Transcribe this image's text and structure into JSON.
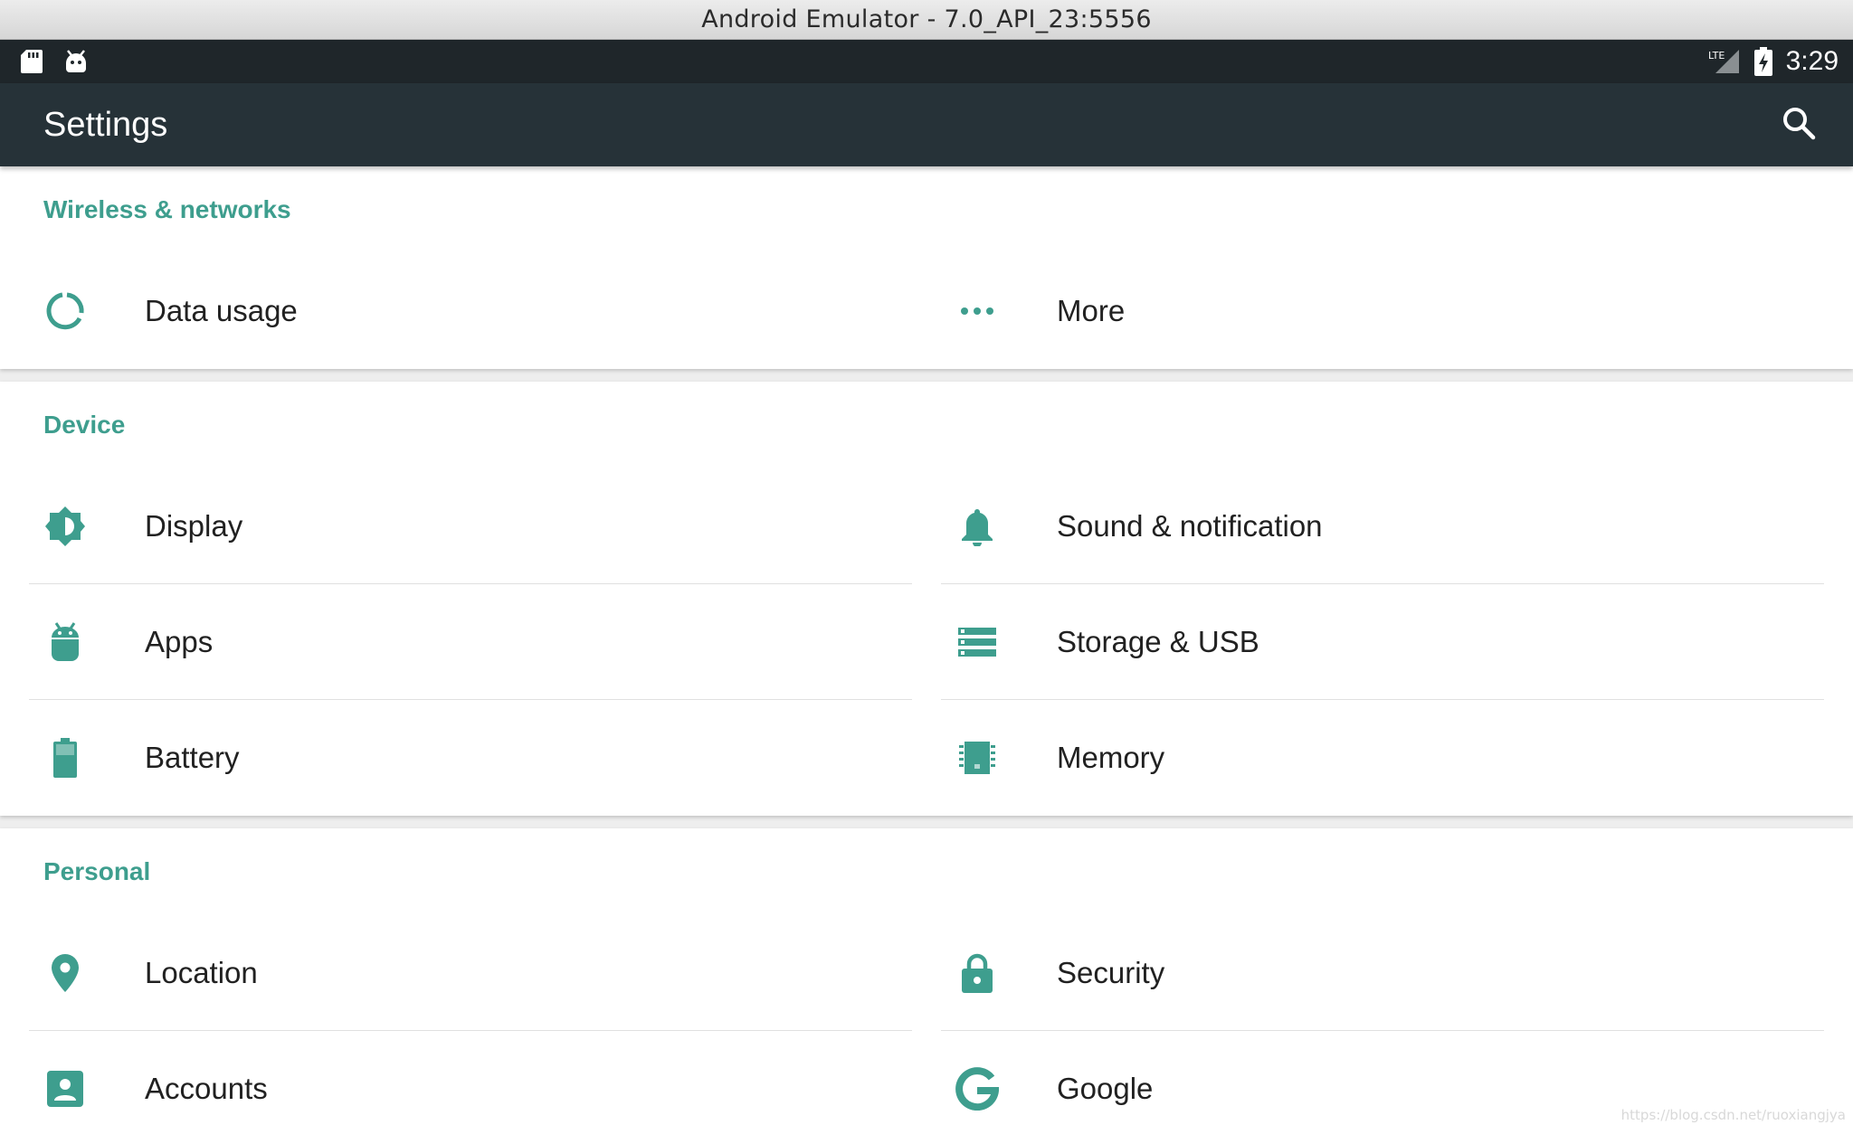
{
  "window": {
    "title": "Android Emulator - 7.0_API_23:5556"
  },
  "status_bar": {
    "left_icons": [
      "sd-card-icon",
      "android-debug-icon"
    ],
    "right_icons": [
      "lte-signal-icon",
      "battery-charging-icon"
    ],
    "network_label": "LTE",
    "time": "3:29"
  },
  "app_bar": {
    "title": "Settings",
    "search_icon": "search-icon"
  },
  "accent_color": "#3e9e8e",
  "sections": [
    {
      "title": "Wireless & networks",
      "items": [
        {
          "label": "Data usage",
          "icon": "data-usage-icon"
        },
        {
          "label": "More",
          "icon": "more-icon"
        }
      ]
    },
    {
      "title": "Device",
      "items": [
        {
          "label": "Display",
          "icon": "brightness-icon"
        },
        {
          "label": "Sound & notification",
          "icon": "bell-icon"
        },
        {
          "label": "Apps",
          "icon": "android-icon"
        },
        {
          "label": "Storage & USB",
          "icon": "storage-icon"
        },
        {
          "label": "Battery",
          "icon": "battery-icon"
        },
        {
          "label": "Memory",
          "icon": "memory-icon"
        }
      ]
    },
    {
      "title": "Personal",
      "items": [
        {
          "label": "Location",
          "icon": "location-icon"
        },
        {
          "label": "Security",
          "icon": "lock-icon"
        },
        {
          "label": "Accounts",
          "icon": "account-icon"
        },
        {
          "label": "Google",
          "icon": "google-icon"
        }
      ]
    }
  ],
  "watermark": "https://blog.csdn.net/ruoxiangjya"
}
